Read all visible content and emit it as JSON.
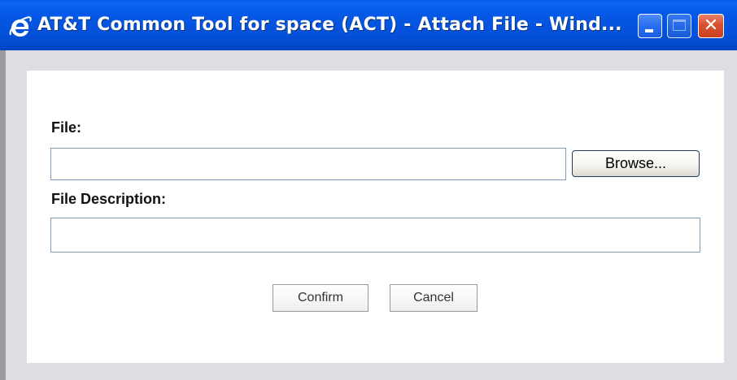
{
  "window": {
    "title": "AT&T Common Tool for space (ACT) - Attach File - Wind...",
    "app_icon": "ie-icon",
    "controls": {
      "minimize": "minimize-icon",
      "maximize": "maximize-icon",
      "close_symbol": "✕"
    },
    "titlebar_color": "#0556e0",
    "close_color": "#d9502f"
  },
  "form": {
    "file_label": "File:",
    "file_value": "",
    "browse_label": "Browse...",
    "description_label": "File Description:",
    "description_value": ""
  },
  "actions": {
    "confirm_label": "Confirm",
    "cancel_label": "Cancel"
  }
}
